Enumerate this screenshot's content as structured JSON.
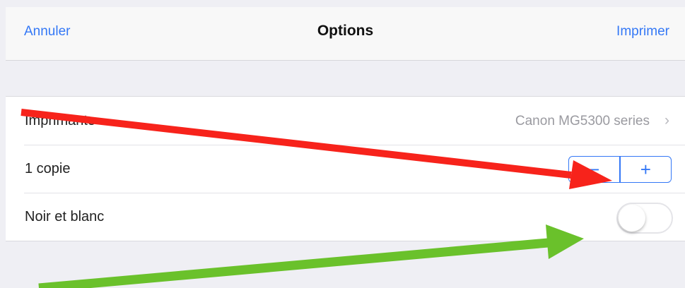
{
  "navbar": {
    "cancel_label": "Annuler",
    "title": "Options",
    "print_label": "Imprimer"
  },
  "rows": [
    {
      "label": "Imprimante",
      "value": "Canon MG5300 series"
    },
    {
      "label": "1 copie",
      "decrement": "−",
      "increment": "+"
    },
    {
      "label": "Noir et blanc",
      "toggle_on": false
    }
  ],
  "colors": {
    "accent": "#3478f6",
    "arrow_red": "#f7231b",
    "arrow_green": "#6ac12b"
  },
  "icons": {
    "chevron": "chevron-right-icon"
  }
}
